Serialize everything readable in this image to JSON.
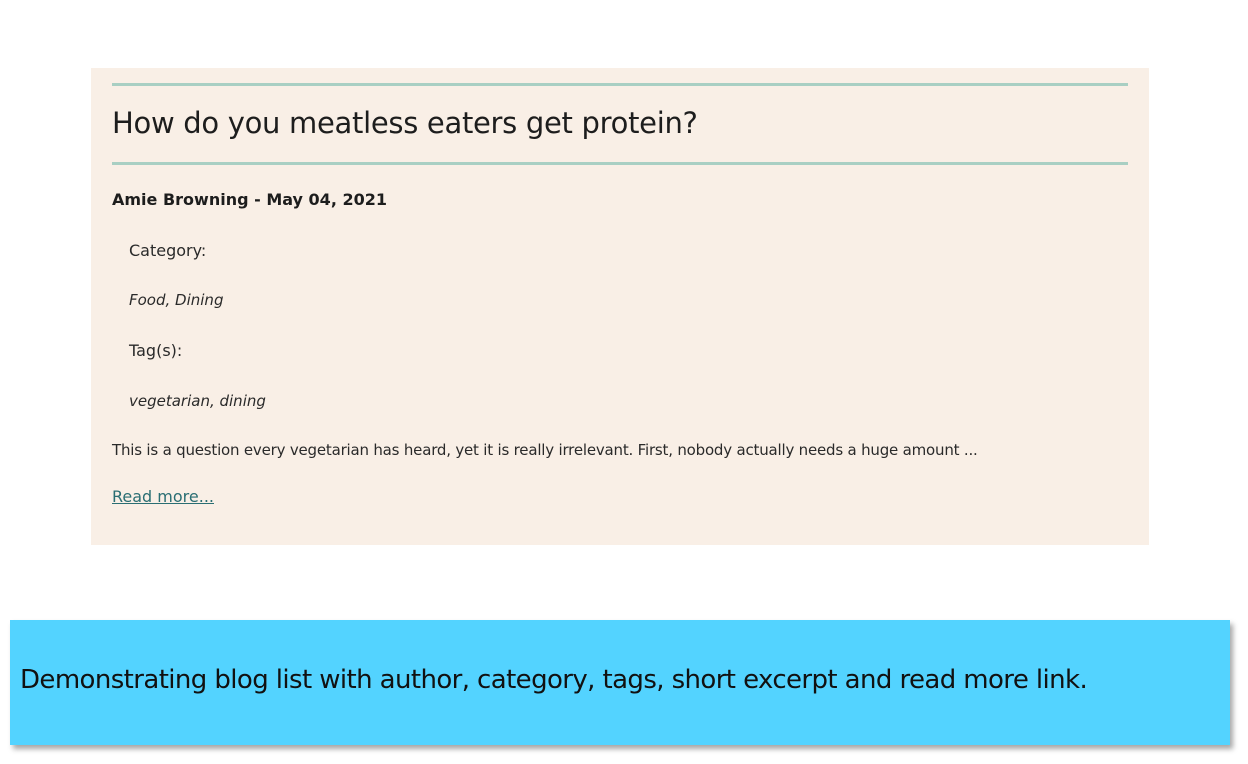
{
  "post": {
    "title": "How do you meatless eaters get protein?",
    "byline": "Amie Browning - May 04, 2021",
    "category_label": "Category:",
    "categories": "Food, Dining",
    "tags_label": "Tag(s):",
    "tags": "vegetarian, dining",
    "excerpt": "This is a question every vegetarian has heard, yet it is really irrelevant. First, nobody actually needs a huge amount ...",
    "read_more": "Read more..."
  },
  "caption": "Demonstrating blog list with author, category, tags, short excerpt and read more link.",
  "colors": {
    "card_bg": "#f9efe6",
    "rule": "#a9cfc3",
    "link": "#2a6e73",
    "caption_bg": "#53d3ff"
  }
}
